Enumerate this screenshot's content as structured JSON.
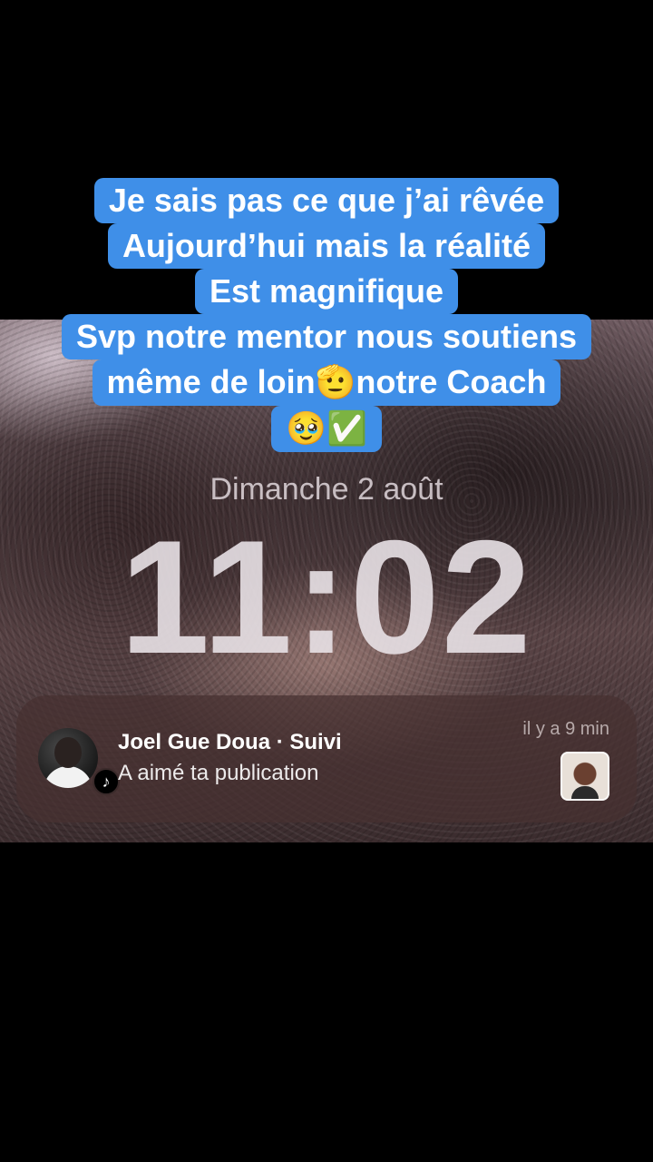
{
  "caption": {
    "lines": [
      "Je sais pas ce que j’ai rêvée",
      "Aujourd’hui mais la réalité",
      "Est magnifique",
      "Svp notre mentor nous soutiens",
      "même de loin",
      "notre Coach"
    ],
    "emoji_pointing": "🫡",
    "emoji_end": "🥹✅"
  },
  "lockscreen": {
    "date": "Dimanche 2 août",
    "time": "11:02"
  },
  "notification": {
    "title": "Joel Gue Doua · Suivi",
    "body": "A aimé ta publication",
    "time": "il y a 9 min",
    "app_badge": "♪"
  },
  "colors": {
    "caption_bg": "#3f8fe8",
    "caption_text": "#ffffff",
    "background": "#000000"
  },
  "icons": [
    "tiktok-icon",
    "avatar",
    "post-thumbnail"
  ]
}
